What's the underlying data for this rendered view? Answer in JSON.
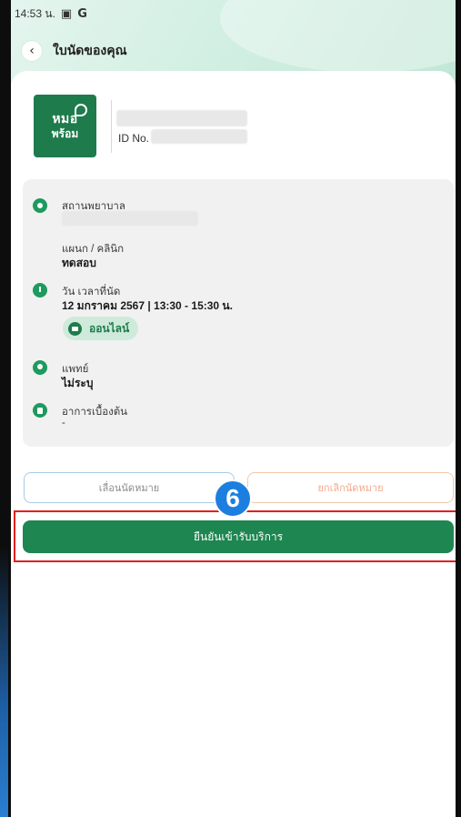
{
  "status_bar": {
    "time": "14:53 น.",
    "icon_a": "▣",
    "icon_b": "G"
  },
  "header": {
    "title": "ใบนัดของคุณ"
  },
  "logo": {
    "line1": "หมอ",
    "line2": "พร้อม"
  },
  "patient": {
    "id_label": "ID No."
  },
  "details": {
    "hospital_label": "สถานพยาบาล",
    "department_label": "แผนก / คลินิก",
    "department_value": "ทดสอบ",
    "datetime_label": "วัน เวลาที่นัด",
    "datetime_value": "12 มกราคม 2567 | 13:30 - 15:30 น.",
    "online_label": "ออนไลน์",
    "doctor_label": "แพทย์",
    "doctor_value": "ไม่ระบุ",
    "symptom_label": "อาการเบื้องต้น",
    "symptom_value": "-"
  },
  "actions": {
    "reschedule_label": "เลื่อนนัดหมาย",
    "cancel_label": "ยกเลิกนัดหมาย",
    "confirm_label": "ยืนยันเข้ารับบริการ"
  },
  "annotation": {
    "step_number": "6"
  },
  "colors": {
    "primary": "#1d8651",
    "accent_blue": "#1c7fe0",
    "highlight_red": "#e0201e"
  }
}
